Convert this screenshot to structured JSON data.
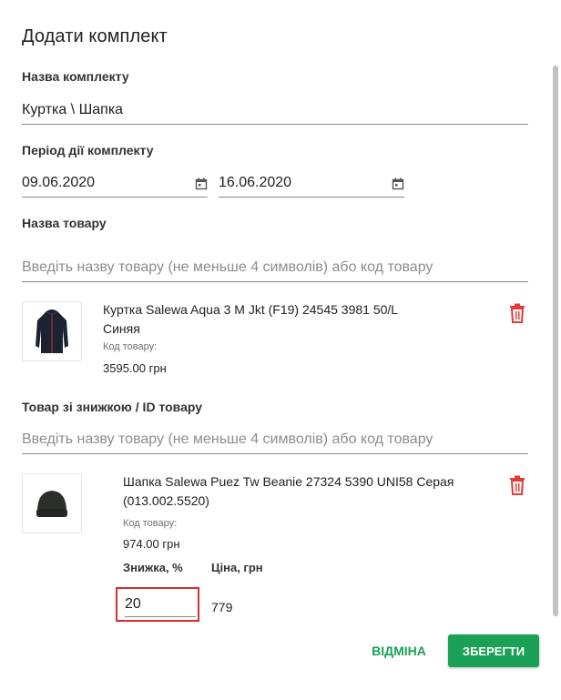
{
  "dialog": {
    "title": "Додати комплект"
  },
  "kit_name": {
    "label": "Назва комплекту",
    "value": "Куртка \\ Шапка"
  },
  "period": {
    "label": "Період дії комплекту",
    "start": "09.06.2020",
    "end": "16.06.2020"
  },
  "product": {
    "label": "Назва товару",
    "placeholder": "Введіть назву товару (не меньше 4 символів) або код товару",
    "item": {
      "name_line1": "Куртка Salewa Aqua 3 M Jkt (F19) 24545 3981 50/L",
      "name_line2": "Синяя",
      "code_label": "Код товару:",
      "price": "3595.00 грн"
    }
  },
  "discount_product": {
    "label": "Товар зі знижкою / ID товару",
    "placeholder": "Введіть назву товару (не меньше 4 символів) або код товару",
    "item": {
      "name_line1": "Шапка Salewa Puez Tw Beanie 27324 5390 UNI58 Серая",
      "name_line2": "(013.002.5520)",
      "code_label": "Код товару:",
      "price": "974.00 грн",
      "discount_header": "Знижка, %",
      "price_header": "Ціна, грн",
      "discount_value": "20",
      "price_value": "779"
    }
  },
  "actions": {
    "cancel": "ВІДМІНА",
    "save": "ЗБЕРЕГТИ"
  },
  "colors": {
    "accent": "#1aa155",
    "delete": "#e53935",
    "highlight": "#d32f2f"
  }
}
